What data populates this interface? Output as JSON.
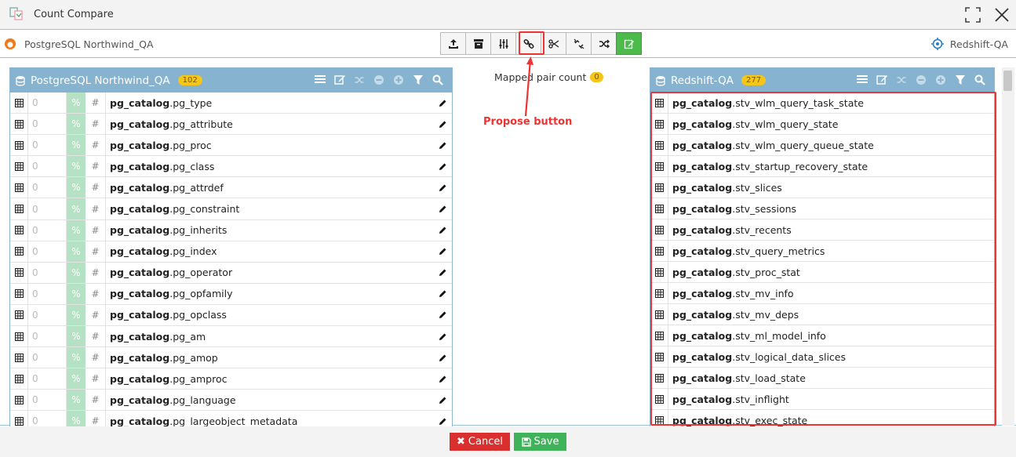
{
  "window": {
    "title": "Count Compare"
  },
  "connections": {
    "source": "PostgreSQL Northwind_QA",
    "target": "Redshift-QA"
  },
  "left_panel": {
    "title": "PostgreSQL Northwind_QA",
    "count": "102",
    "rows": [
      {
        "count": "0",
        "pct": "%",
        "hash": "#",
        "schema": "pg_catalog",
        "table": ".pg_type"
      },
      {
        "count": "0",
        "pct": "%",
        "hash": "#",
        "schema": "pg_catalog",
        "table": ".pg_attribute"
      },
      {
        "count": "0",
        "pct": "%",
        "hash": "#",
        "schema": "pg_catalog",
        "table": ".pg_proc"
      },
      {
        "count": "0",
        "pct": "%",
        "hash": "#",
        "schema": "pg_catalog",
        "table": ".pg_class"
      },
      {
        "count": "0",
        "pct": "%",
        "hash": "#",
        "schema": "pg_catalog",
        "table": ".pg_attrdef"
      },
      {
        "count": "0",
        "pct": "%",
        "hash": "#",
        "schema": "pg_catalog",
        "table": ".pg_constraint"
      },
      {
        "count": "0",
        "pct": "%",
        "hash": "#",
        "schema": "pg_catalog",
        "table": ".pg_inherits"
      },
      {
        "count": "0",
        "pct": "%",
        "hash": "#",
        "schema": "pg_catalog",
        "table": ".pg_index"
      },
      {
        "count": "0",
        "pct": "%",
        "hash": "#",
        "schema": "pg_catalog",
        "table": ".pg_operator"
      },
      {
        "count": "0",
        "pct": "%",
        "hash": "#",
        "schema": "pg_catalog",
        "table": ".pg_opfamily"
      },
      {
        "count": "0",
        "pct": "%",
        "hash": "#",
        "schema": "pg_catalog",
        "table": ".pg_opclass"
      },
      {
        "count": "0",
        "pct": "%",
        "hash": "#",
        "schema": "pg_catalog",
        "table": ".pg_am"
      },
      {
        "count": "0",
        "pct": "%",
        "hash": "#",
        "schema": "pg_catalog",
        "table": ".pg_amop"
      },
      {
        "count": "0",
        "pct": "%",
        "hash": "#",
        "schema": "pg_catalog",
        "table": ".pg_amproc"
      },
      {
        "count": "0",
        "pct": "%",
        "hash": "#",
        "schema": "pg_catalog",
        "table": ".pg_language"
      },
      {
        "count": "0",
        "pct": "%",
        "hash": "#",
        "schema": "pg_catalog",
        "table": ".pg_largeobject_metadata"
      }
    ]
  },
  "mapped": {
    "label": "Mapped pair count",
    "count": "0"
  },
  "annotation": {
    "callout": "Propose button"
  },
  "right_panel": {
    "title": "Redshift-QA",
    "count": "277",
    "rows": [
      {
        "schema": "pg_catalog",
        "table": ".stv_wlm_query_task_state"
      },
      {
        "schema": "pg_catalog",
        "table": ".stv_wlm_query_state"
      },
      {
        "schema": "pg_catalog",
        "table": ".stv_wlm_query_queue_state"
      },
      {
        "schema": "pg_catalog",
        "table": ".stv_startup_recovery_state"
      },
      {
        "schema": "pg_catalog",
        "table": ".stv_slices"
      },
      {
        "schema": "pg_catalog",
        "table": ".stv_sessions"
      },
      {
        "schema": "pg_catalog",
        "table": ".stv_recents"
      },
      {
        "schema": "pg_catalog",
        "table": ".stv_query_metrics"
      },
      {
        "schema": "pg_catalog",
        "table": ".stv_proc_stat"
      },
      {
        "schema": "pg_catalog",
        "table": ".stv_mv_info"
      },
      {
        "schema": "pg_catalog",
        "table": ".stv_mv_deps"
      },
      {
        "schema": "pg_catalog",
        "table": ".stv_ml_model_info"
      },
      {
        "schema": "pg_catalog",
        "table": ".stv_logical_data_slices"
      },
      {
        "schema": "pg_catalog",
        "table": ".stv_load_state"
      },
      {
        "schema": "pg_catalog",
        "table": ".stv_inflight"
      },
      {
        "schema": "pg_catalog",
        "table": ".stv_exec_state"
      }
    ]
  },
  "footer": {
    "cancel_label": "Cancel",
    "save_label": "Save"
  },
  "colors": {
    "header": "#86b3cf",
    "badge": "#f5c518",
    "cancel": "#d9302f",
    "save": "#3fb35a",
    "highlight": "#e33333",
    "pct_cell": "#b5e1c4"
  },
  "icons": {
    "toolbar": [
      "upload-icon",
      "archive-icon",
      "sliders-icon",
      "link-icon",
      "scissors-icon",
      "unlink-icon",
      "shuffle-icon",
      "edit-icon"
    ],
    "panel_header": [
      "list-icon",
      "edit-icon",
      "shuffle-icon",
      "minus-circle-icon",
      "plus-circle-icon",
      "filter-icon",
      "search-icon"
    ]
  }
}
